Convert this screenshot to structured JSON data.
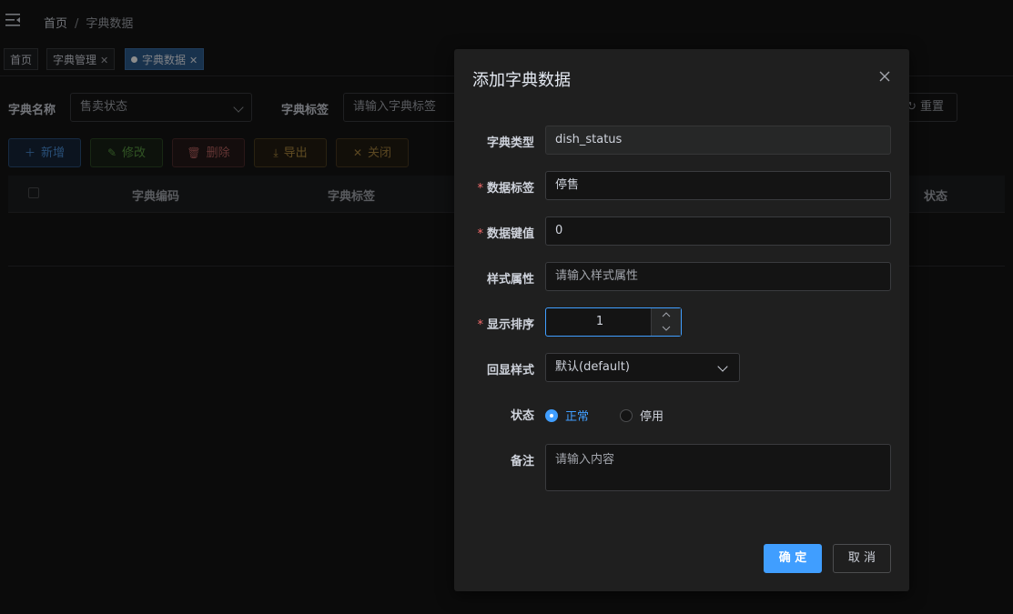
{
  "header": {
    "breadcrumb": [
      "首页",
      "字典数据"
    ],
    "separator": "/"
  },
  "tags": [
    {
      "label": "首页"
    },
    {
      "label": "字典管理"
    },
    {
      "label": "字典数据"
    }
  ],
  "search": {
    "dict_name_label": "字典名称",
    "dict_name_value": "售卖状态",
    "dict_tag_label": "字典标签",
    "dict_tag_placeholder": "请输入字典标签",
    "reset_label": "重置"
  },
  "toolbar": {
    "add": "新增",
    "edit": "修改",
    "delete": "删除",
    "export": "导出",
    "close": "关闭"
  },
  "table": {
    "columns": [
      "字典编码",
      "字典标签",
      "状态"
    ]
  },
  "dialog": {
    "title": "添加字典数据",
    "fields": {
      "dict_type_label": "字典类型",
      "dict_type_value": "dish_status",
      "data_label_label": "数据标签",
      "data_label_value": "停售",
      "data_value_label": "数据键值",
      "data_value_value": "0",
      "css_label": "样式属性",
      "css_placeholder": "请输入样式属性",
      "sort_label": "显示排序",
      "sort_value": "1",
      "echo_label": "回显样式",
      "echo_value": "默认(default)",
      "status_label": "状态",
      "status_options": [
        "正常",
        "停用"
      ],
      "status_selected": "正常",
      "remark_label": "备注",
      "remark_placeholder": "请输入内容"
    },
    "required_mark": "*",
    "confirm": "确 定",
    "cancel": "取 消"
  },
  "colors": {
    "primary": "#409eff",
    "danger": "#f56c6c",
    "background": "#141414"
  }
}
